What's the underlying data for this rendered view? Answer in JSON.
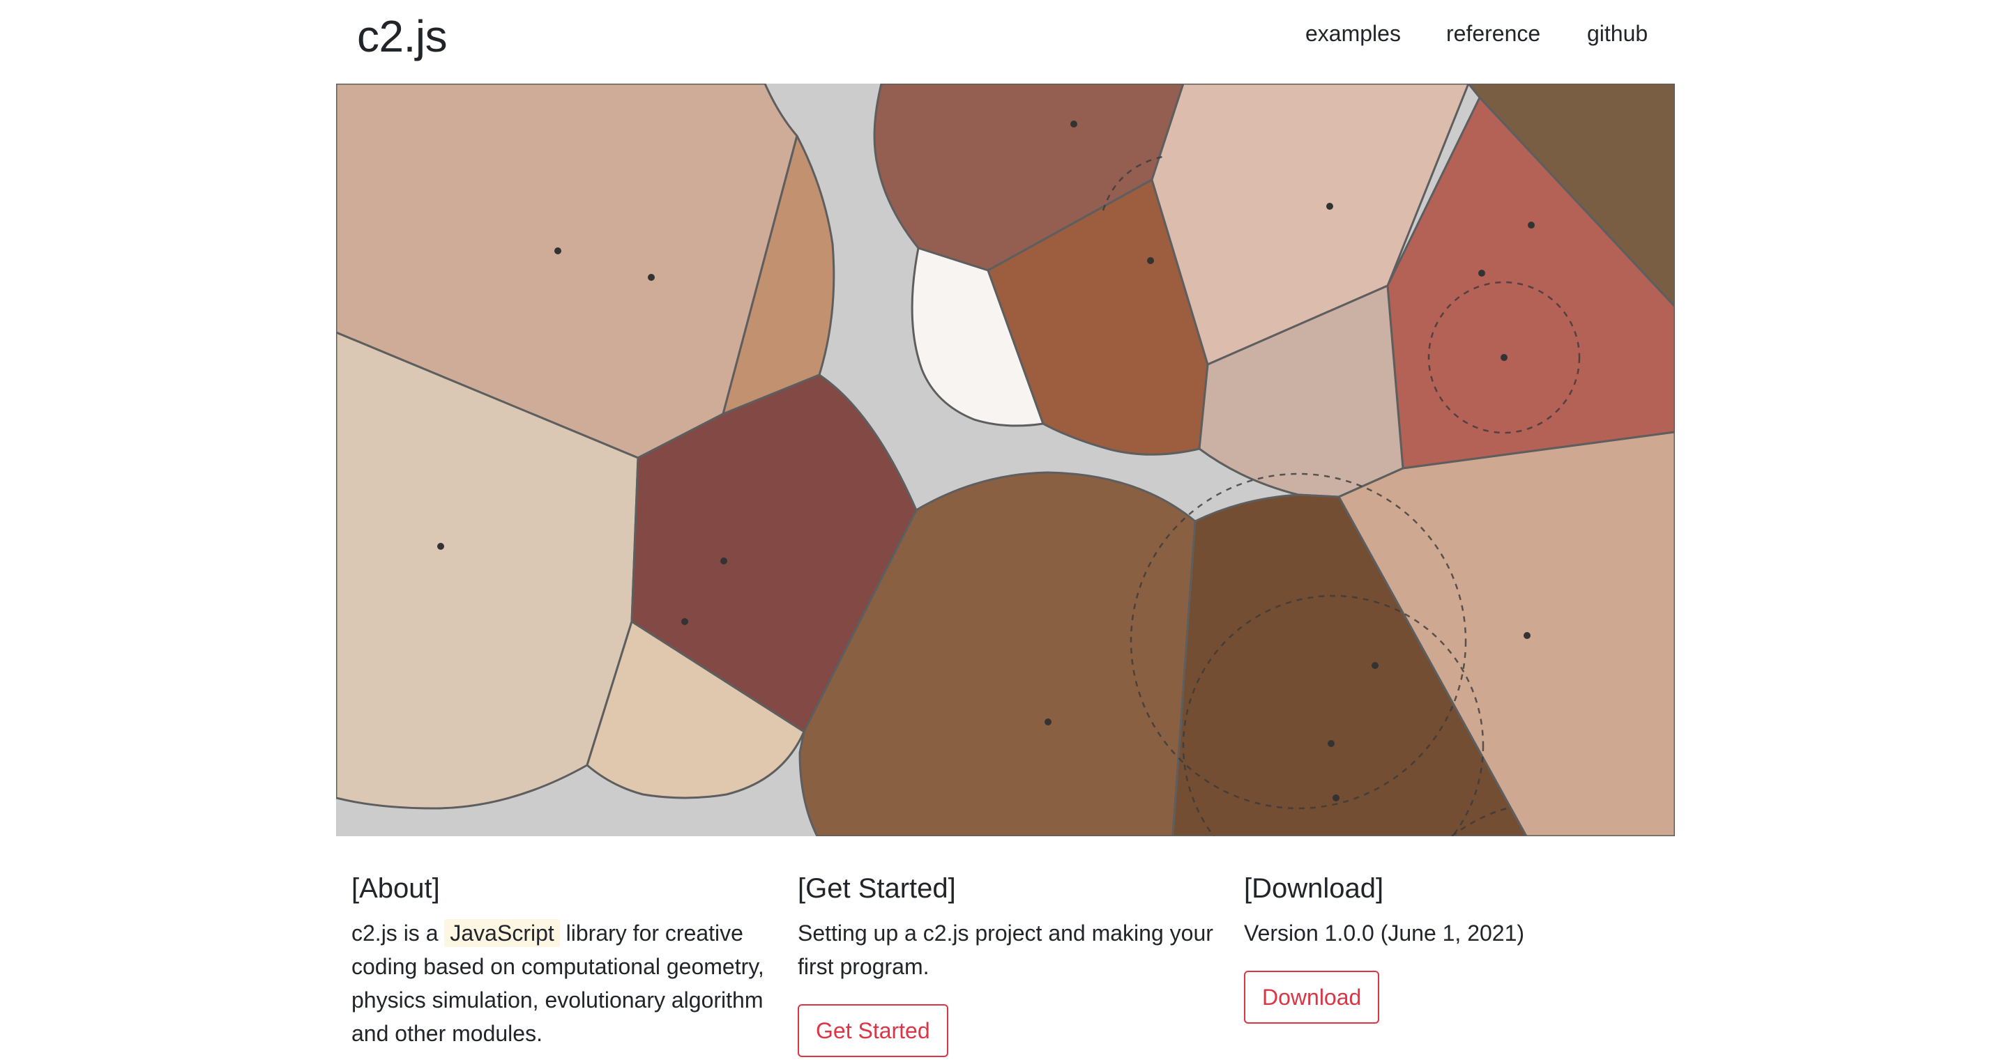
{
  "navbar": {
    "brand": "c2.js",
    "links": [
      "examples",
      "reference",
      "github"
    ]
  },
  "hero": {
    "colors": {
      "background": "#cccccc",
      "stroke": "#5e5e5e",
      "dot": "#333333"
    }
  },
  "about": {
    "heading": "[About]",
    "text_before": "c2.js is a ",
    "highlight": "JavaScript",
    "text_after": " library for creative coding based on computational geometry, physics simulation, evolutionary algorithm and other modules."
  },
  "get_started": {
    "heading": "[Get Started]",
    "text": "Setting up a c2.js project and making your first program.",
    "button_label": "Get Started"
  },
  "download": {
    "heading": "[Download]",
    "text": "Version 1.0.0 (June 1, 2021)",
    "button_label": "Download"
  },
  "colors": {
    "accent": "#dc3545",
    "text": "#212529",
    "highlight_bg": "#fdf6e3"
  }
}
